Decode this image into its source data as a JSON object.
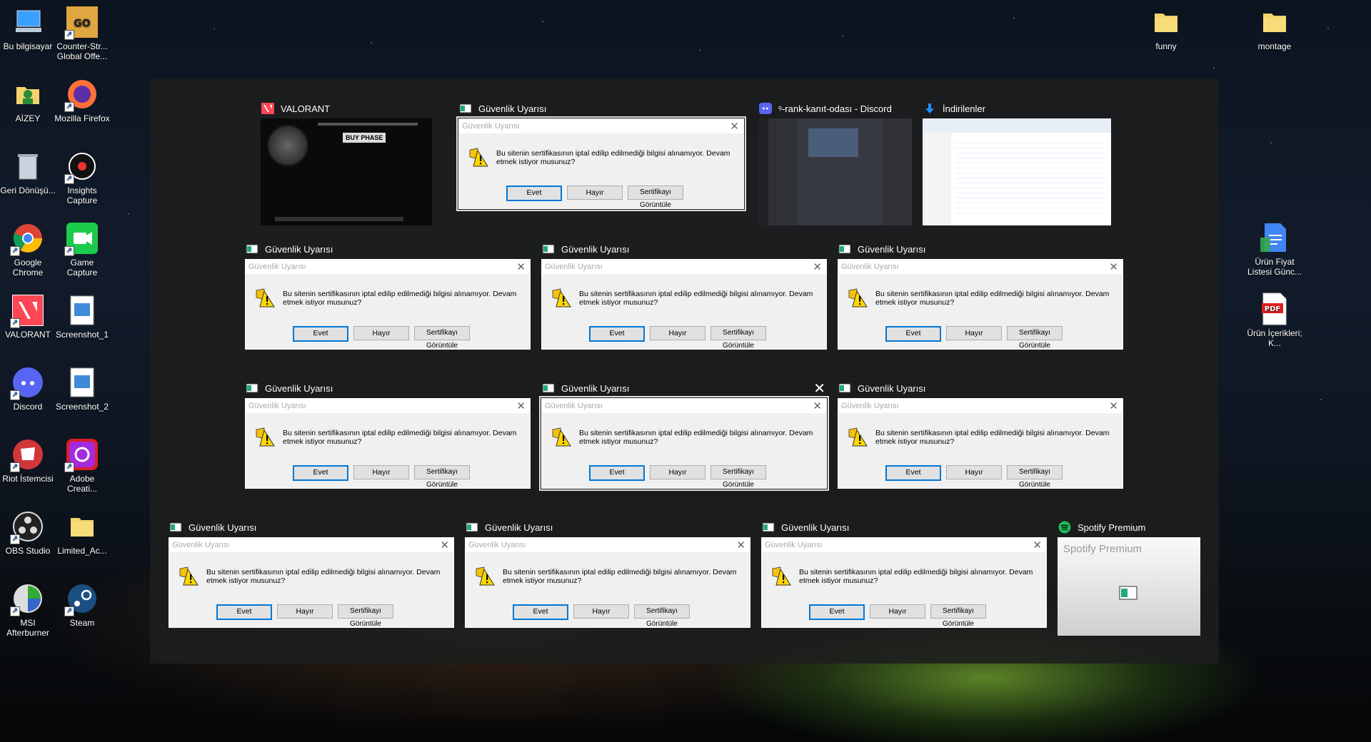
{
  "desktop_left": [
    {
      "label": "Bu bilgisayar",
      "icon": "computer-icon"
    },
    {
      "label": "Counter-Str... Global Offe...",
      "icon": "csgo-icon"
    },
    {
      "label": "AİZEY",
      "icon": "user-folder-icon"
    },
    {
      "label": "Mozilla Firefox",
      "icon": "firefox-icon"
    },
    {
      "label": "Geri Dönüşü...",
      "icon": "recycle-bin-icon"
    },
    {
      "label": "Insights Capture",
      "icon": "insights-capture-icon"
    },
    {
      "label": "Google Chrome",
      "icon": "chrome-icon"
    },
    {
      "label": "Game Capture",
      "icon": "game-capture-icon"
    },
    {
      "label": "VALORANT",
      "icon": "valorant-icon"
    },
    {
      "label": "Screenshot_1",
      "icon": "image-file-icon"
    },
    {
      "label": "Discord",
      "icon": "discord-icon"
    },
    {
      "label": "Screenshot_2",
      "icon": "image-file-icon"
    },
    {
      "label": "Riot İstemcisi",
      "icon": "riot-client-icon"
    },
    {
      "label": "Adobe Creati...",
      "icon": "adobe-cc-icon"
    },
    {
      "label": "OBS Studio",
      "icon": "obs-icon"
    },
    {
      "label": "Limited_Ac...",
      "icon": "folder-icon"
    },
    {
      "label": "MSI Afterburner",
      "icon": "msi-afterburner-icon"
    },
    {
      "label": "Steam",
      "icon": "steam-icon"
    }
  ],
  "desktop_right": [
    {
      "label": "funny",
      "icon": "folder-icon"
    },
    {
      "label": "montage",
      "icon": "folder-icon"
    },
    {
      "label": "Ürün Fiyat Listesi Günc...",
      "icon": "google-docs-icon"
    },
    {
      "label": "Ürün İçerikleri; K...",
      "icon": "pdf-icon"
    }
  ],
  "dialog": {
    "title": "Güvenlik Uyarısı",
    "message": "Bu sitenin sertifikasının iptal edilip edilmediği bilgisi alınamıyor. Devam etmek istiyor musunuz?",
    "yes": "Evet",
    "no": "Hayır",
    "view": "Sertifikayı Görüntüle"
  },
  "windows": {
    "valorant": "VALORANT",
    "valorant_buy": "BUY PHASE",
    "security": "Güvenlik Uyarısı",
    "discord": "ꝰ-rank-kanıt-odası - Discord",
    "downloads": "İndirilenler",
    "spotify": "Spotify Premium",
    "spotify_inner": "Spotify Premium"
  },
  "colors": {
    "accent": "#0078d7",
    "overlay": "#1e1e1e",
    "valorant": "#ff4655",
    "discord": "#5865f2",
    "spotify": "#1db954"
  }
}
